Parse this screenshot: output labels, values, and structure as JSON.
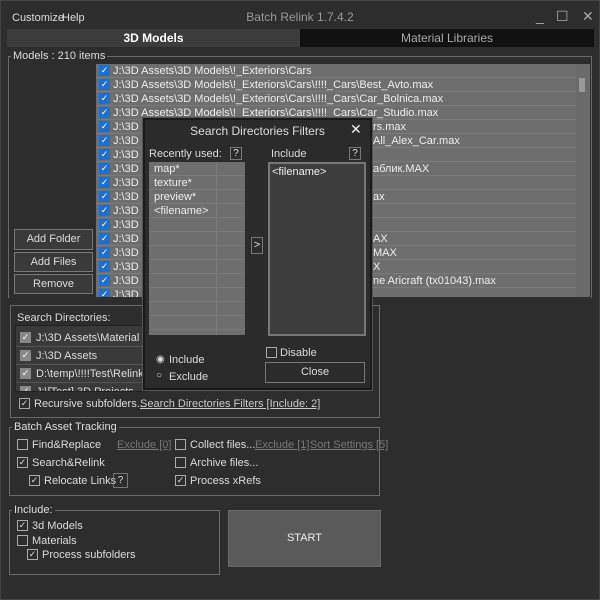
{
  "menu": {
    "customize": "Customize",
    "help": "Help"
  },
  "window": {
    "title": "Batch Relink 1.7.4.2",
    "minimize": "_",
    "maximize": "☐",
    "close": "✕"
  },
  "tabs": [
    {
      "label": "3D Models",
      "active": true
    },
    {
      "label": "Material Libraries",
      "active": false
    }
  ],
  "models": {
    "label": "Models : 210 items",
    "rows": [
      {
        "left": "J:\\3D Assets\\3D Models\\!_Exteriors\\Cars",
        "right": ""
      },
      {
        "left": "J:\\3D Assets\\3D Models\\!_Exteriors\\Cars\\!!!!_Cars\\Best_Avto.max",
        "right": ""
      },
      {
        "left": "J:\\3D Assets\\3D Models\\!_Exteriors\\Cars\\!!!!_Cars\\Car_Bolnica.max",
        "right": ""
      },
      {
        "left": "J:\\3D Assets\\3D Models\\!_Exteriors\\Cars\\!!!!_Cars\\Car_Studio.max",
        "right": ""
      },
      {
        "left": "J:\\3D",
        "right": "rs.max"
      },
      {
        "left": "J:\\3D",
        "right": "All_Alex_Car.max"
      },
      {
        "left": "J:\\3D",
        "right": ""
      },
      {
        "left": "J:\\3D",
        "right": "аблик.MAX"
      },
      {
        "left": "J:\\3D",
        "right": ""
      },
      {
        "left": "J:\\3D",
        "right": "ax"
      },
      {
        "left": "J:\\3D",
        "right": ""
      },
      {
        "left": "J:\\3D",
        "right": ""
      },
      {
        "left": "J:\\3D",
        "right": "AX"
      },
      {
        "left": "J:\\3D",
        "right": "MAX"
      },
      {
        "left": "J:\\3D",
        "right": "X"
      },
      {
        "left": "J:\\3D",
        "right": "ne Aricraft (tx01043).max"
      },
      {
        "left": "J:\\3D",
        "right": ""
      }
    ],
    "add_folder": "Add Folder",
    "add_files": "Add Files",
    "remove": "Remove"
  },
  "search_dirs": {
    "label": "Search Directories:",
    "items": [
      "J:\\3D Assets\\Material",
      "J:\\3D Assets",
      "D:\\temp\\!!!!Test\\Relink-Te",
      "J:\\[Test] 3D Projects"
    ],
    "recursive": "Recursive subfolders...",
    "filters_link": "Search Directories Filters [Include: 2]"
  },
  "dialog": {
    "title": "Search Directories Filters",
    "close_icon": "✕",
    "recently_used": "Recently used:",
    "help": "?",
    "recent_items": [
      "map*",
      "texture*",
      "preview*",
      "<filename>"
    ],
    "move": ">",
    "include_label": "Include",
    "include_items": [
      "<filename>"
    ],
    "radio_include": "Include",
    "radio_exclude": "Exclude",
    "mode": "Include",
    "disable": "Disable",
    "close_button": "Close"
  },
  "batch": {
    "label": "Batch Asset Tracking",
    "find_replace": "Find&Replace",
    "exclude0": "Exclude [0]",
    "collect": "Collect files...",
    "exclude1": "Exclude [1]",
    "sort": "Sort Settings [5]",
    "search_relink": "Search&Relink",
    "archive": "Archive files...",
    "relocate": "Relocate Links",
    "help": "?",
    "xrefs": "Process xRefs"
  },
  "include": {
    "label": "Include:",
    "models": "3d Models",
    "materials": "Materials",
    "subfolders": "Process subfolders"
  },
  "start": "START",
  "colors": {
    "accent": "#1d6fd0",
    "bg": "#2d2d2d",
    "list": "#6e6e6e"
  }
}
